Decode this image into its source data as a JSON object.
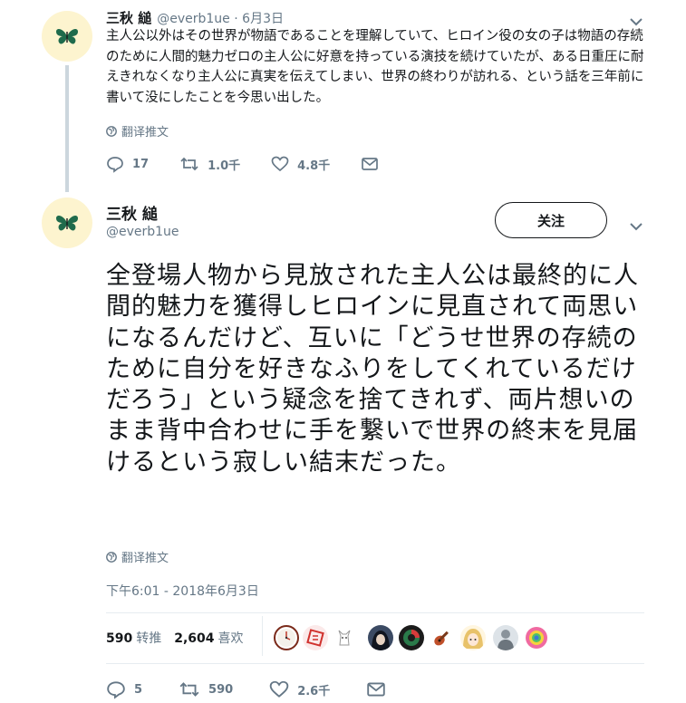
{
  "tweet1": {
    "name": "三秋 縋",
    "handle": "@everb1ue",
    "sep": " · ",
    "date": "6月3日",
    "text": "主人公以外はその世界が物語であることを理解していて、ヒロイン役の女の子は物語の存続のために人間的魅力ゼロの主人公に好意を持っている演技を続けていたが、ある日重圧に耐えきれなくなり主人公に真実を伝えてしまい、世界の終わりが訪れる、という話を三年前に書いて没にしたことを今思い出した。",
    "translate": "翻译推文",
    "replies": "17",
    "retweets": "1.0千",
    "likes": "4.8千"
  },
  "tweet2": {
    "name": "三秋 縋",
    "handle": "@everb1ue",
    "follow": "关注",
    "text": "全登場人物から見放された主人公は最終的に人間的魅力を獲得しヒロインに見直されて両思いになるんだけど、互いに「どうせ世界の存続のために自分を好きなふりをしてくれているだけだろう」という疑念を捨てきれず、両片想いのまま背中合わせに手を繋いで世界の終末を見届けるという寂しい結末だった。",
    "translate": "翻译推文",
    "timestamp": "下午6:01 - 2018年6月3日",
    "retweet_count": "590",
    "retweet_label": "转推",
    "like_count": "2,604",
    "like_label": "喜欢",
    "replies": "5",
    "retweets": "590",
    "likes": "2.6千"
  },
  "icons": {
    "avatar": "green-butterfly",
    "reply": "speech-bubble-icon",
    "retweet": "retweet-arrows-icon",
    "like": "heart-icon",
    "dm": "envelope-icon",
    "translate": "globe-icon",
    "menu": "chevron-down-icon"
  },
  "likers": [
    "clock",
    "red-stamp",
    "white-goat",
    "dark-hair",
    "dark-circle",
    "guitar",
    "anime-girl",
    "gray-figure",
    "colorful-flower"
  ],
  "colors": {
    "text": "#14171a",
    "secondary": "#657786",
    "avatar_bg": "#fdf4cf",
    "butterfly": "#1f6b4c"
  }
}
